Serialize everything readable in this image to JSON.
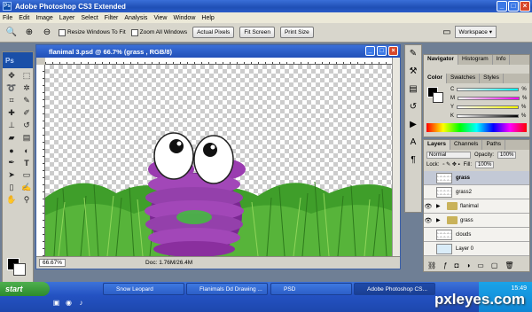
{
  "app": {
    "title": "Adobe Photoshop CS3 Extended",
    "logo": "Ps"
  },
  "menu": [
    "File",
    "Edit",
    "Image",
    "Layer",
    "Select",
    "Filter",
    "Analysis",
    "View",
    "Window",
    "Help"
  ],
  "options": {
    "resize_label": "Resize Windows To Fit",
    "zoom_all_label": "Zoom All Windows",
    "actual_pixels": "Actual Pixels",
    "fit_screen": "Fit Screen",
    "print_size": "Print Size",
    "workspace": "Workspace ▾"
  },
  "document": {
    "title": "flanimal 3.psd @ 66.7% (grass , RGB/8)",
    "zoom": "66.67%",
    "doc_info": "Doc: 1.76M/26.4M"
  },
  "panels": {
    "nav_tabs": [
      "Navigator",
      "Histogram",
      "Info"
    ],
    "color_tabs": [
      "Color",
      "Swatches",
      "Styles"
    ],
    "color_channels": [
      {
        "label": "C",
        "value": "%"
      },
      {
        "label": "M",
        "value": "%"
      },
      {
        "label": "Y",
        "value": "%"
      },
      {
        "label": "K",
        "value": "%"
      }
    ],
    "layer_tabs": [
      "Layers",
      "Channels",
      "Paths"
    ],
    "blend_mode": "Normal",
    "opacity_label": "Opacity:",
    "opacity_value": "100%",
    "lock_label": "Lock:",
    "fill_label": "Fill:",
    "fill_value": "100%",
    "layers": [
      {
        "name": "grass",
        "visible": false,
        "type": "thumb",
        "selected": true
      },
      {
        "name": "grass2",
        "visible": false,
        "type": "thumb",
        "selected": false
      },
      {
        "name": "flanimal",
        "visible": true,
        "type": "folder",
        "selected": false
      },
      {
        "name": "grass",
        "visible": true,
        "type": "folder",
        "selected": false
      },
      {
        "name": "clouds",
        "visible": false,
        "type": "thumb",
        "selected": false
      },
      {
        "name": "Layer 0",
        "visible": false,
        "type": "plain",
        "selected": false
      }
    ]
  },
  "taskbar": {
    "start": "start",
    "tasks": [
      "Snow Leopard",
      "Flanimals Dd Drawing ...",
      "PSD",
      "Adobe Photoshop CS..."
    ],
    "time": "15:49",
    "watermark": "pxleyes.com"
  },
  "colors": {
    "accent_blue": "#2150b8",
    "creature_purple": "#8a2f9e",
    "grass_green": "#3f9e2a"
  }
}
